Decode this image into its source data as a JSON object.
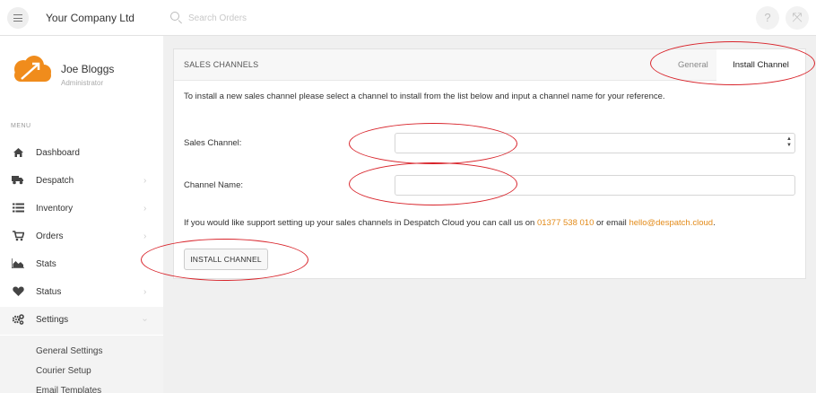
{
  "topbar": {
    "company": "Your Company Ltd",
    "search_placeholder": "Search Orders",
    "help_glyph": "?",
    "expand_glyph": "⤧"
  },
  "user": {
    "name": "Joe Bloggs",
    "role": "Administrator"
  },
  "sidebar": {
    "menu_label": "MENU",
    "items": [
      {
        "label": "Dashboard",
        "icon": "home-icon",
        "chevron": false
      },
      {
        "label": "Despatch",
        "icon": "truck-icon",
        "chevron": true
      },
      {
        "label": "Inventory",
        "icon": "list-icon",
        "chevron": true
      },
      {
        "label": "Orders",
        "icon": "cart-icon",
        "chevron": true
      },
      {
        "label": "Stats",
        "icon": "area-chart-icon",
        "chevron": false
      },
      {
        "label": "Status",
        "icon": "heart-icon",
        "chevron": true
      },
      {
        "label": "Settings",
        "icon": "gears-icon",
        "chevron": true,
        "expanded": true
      }
    ],
    "sub_items": [
      "General Settings",
      "Courier Setup",
      "Email Templates"
    ]
  },
  "panel": {
    "title": "SALES CHANNELS",
    "tabs": [
      {
        "label": "General",
        "active": false
      },
      {
        "label": "Install Channel",
        "active": true
      }
    ],
    "intro": "To install a new sales channel please select a channel to install from the list below and input a channel name for your reference.",
    "sales_channel_label": "Sales Channel:",
    "sales_channel_value": "",
    "channel_name_label": "Channel Name:",
    "channel_name_value": "",
    "support_prefix": "If you would like support setting up your sales channels in Despatch Cloud you can call us on ",
    "phone": "01377 538 010",
    "support_middle": " or email ",
    "email": "hello@despatch.cloud",
    "support_suffix": ".",
    "install_button": "INSTALL CHANNEL"
  },
  "colors": {
    "accent_link": "#e38b1a",
    "annotation": "#d8232a",
    "logo_orange": "#f08c1c"
  }
}
